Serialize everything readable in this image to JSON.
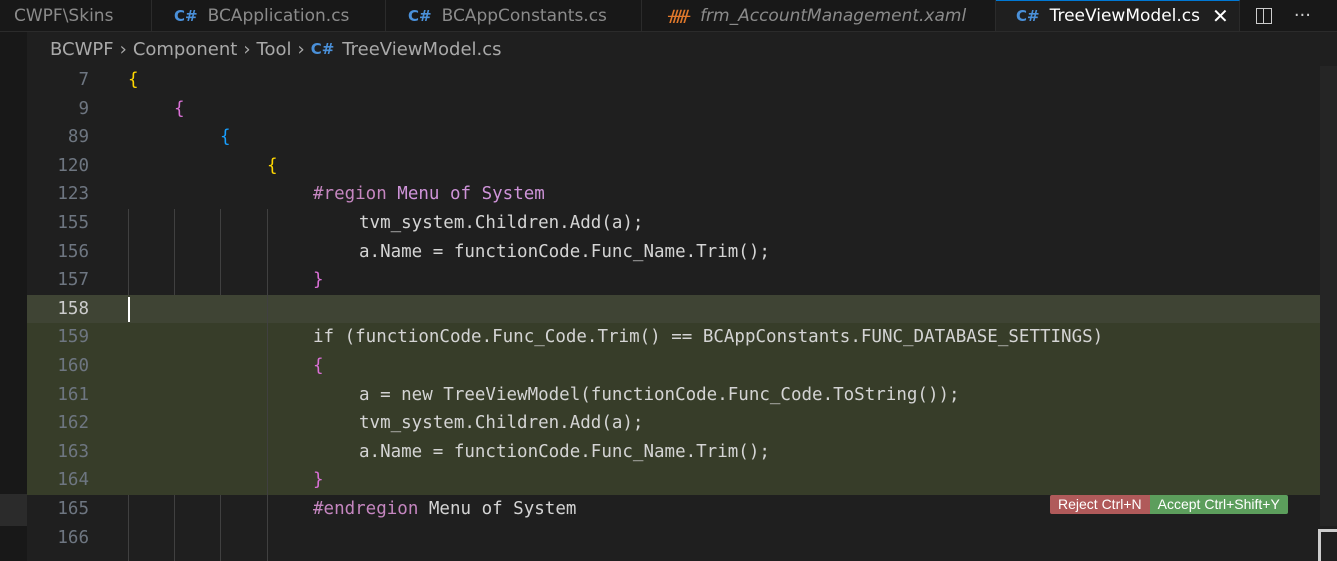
{
  "tabs": [
    {
      "label": "CWPF\\Skins",
      "icon": "folder",
      "active": false
    },
    {
      "label": "BCApplication.cs",
      "icon": "csharp-icon",
      "active": false
    },
    {
      "label": "BCAppConstants.cs",
      "icon": "csharp-icon",
      "active": false
    },
    {
      "label": "frm_AccountManagement.xaml",
      "icon": "rss-icon",
      "active": false
    },
    {
      "label": "TreeViewModel.cs",
      "icon": "csharp-icon",
      "active": true
    }
  ],
  "tab_actions": {
    "more": "···"
  },
  "breadcrumb": [
    "BCWPF",
    "Component",
    "Tool",
    "TreeViewModel.cs"
  ],
  "line_numbers": [
    "7",
    "9",
    "89",
    "120",
    "123",
    "155",
    "156",
    "157",
    "158",
    "159",
    "160",
    "161",
    "162",
    "163",
    "164",
    "165",
    "166"
  ],
  "code": {
    "l7": "{",
    "l9": "{",
    "l89": "{",
    "l120": "{",
    "l123_kw": "#region",
    "l123_rest": " Menu of System",
    "l155": "tvm_system.Children.Add(a);",
    "l156": "a.Name = functionCode.Func_Name.Trim();",
    "l157": "}",
    "l159": "if (functionCode.Func_Code.Trim() == BCAppConstants.FUNC_DATABASE_SETTINGS)",
    "l160": "{",
    "l161": "a = new TreeViewModel(functionCode.Func_Code.ToString());",
    "l162": "tvm_system.Children.Add(a);",
    "l163": "a.Name = functionCode.Func_Name.Trim();",
    "l164": "}",
    "l165_kw": "#endregion",
    "l165_rest": " Menu of System"
  },
  "diff_actions": {
    "reject": "Reject Ctrl+N",
    "accept": "Accept Ctrl+Shift+Y"
  },
  "colors": {
    "diff_bg": "#373d29",
    "reject": "#b05a5a",
    "accept": "#5c9e5c",
    "accent": "#0078d4"
  }
}
